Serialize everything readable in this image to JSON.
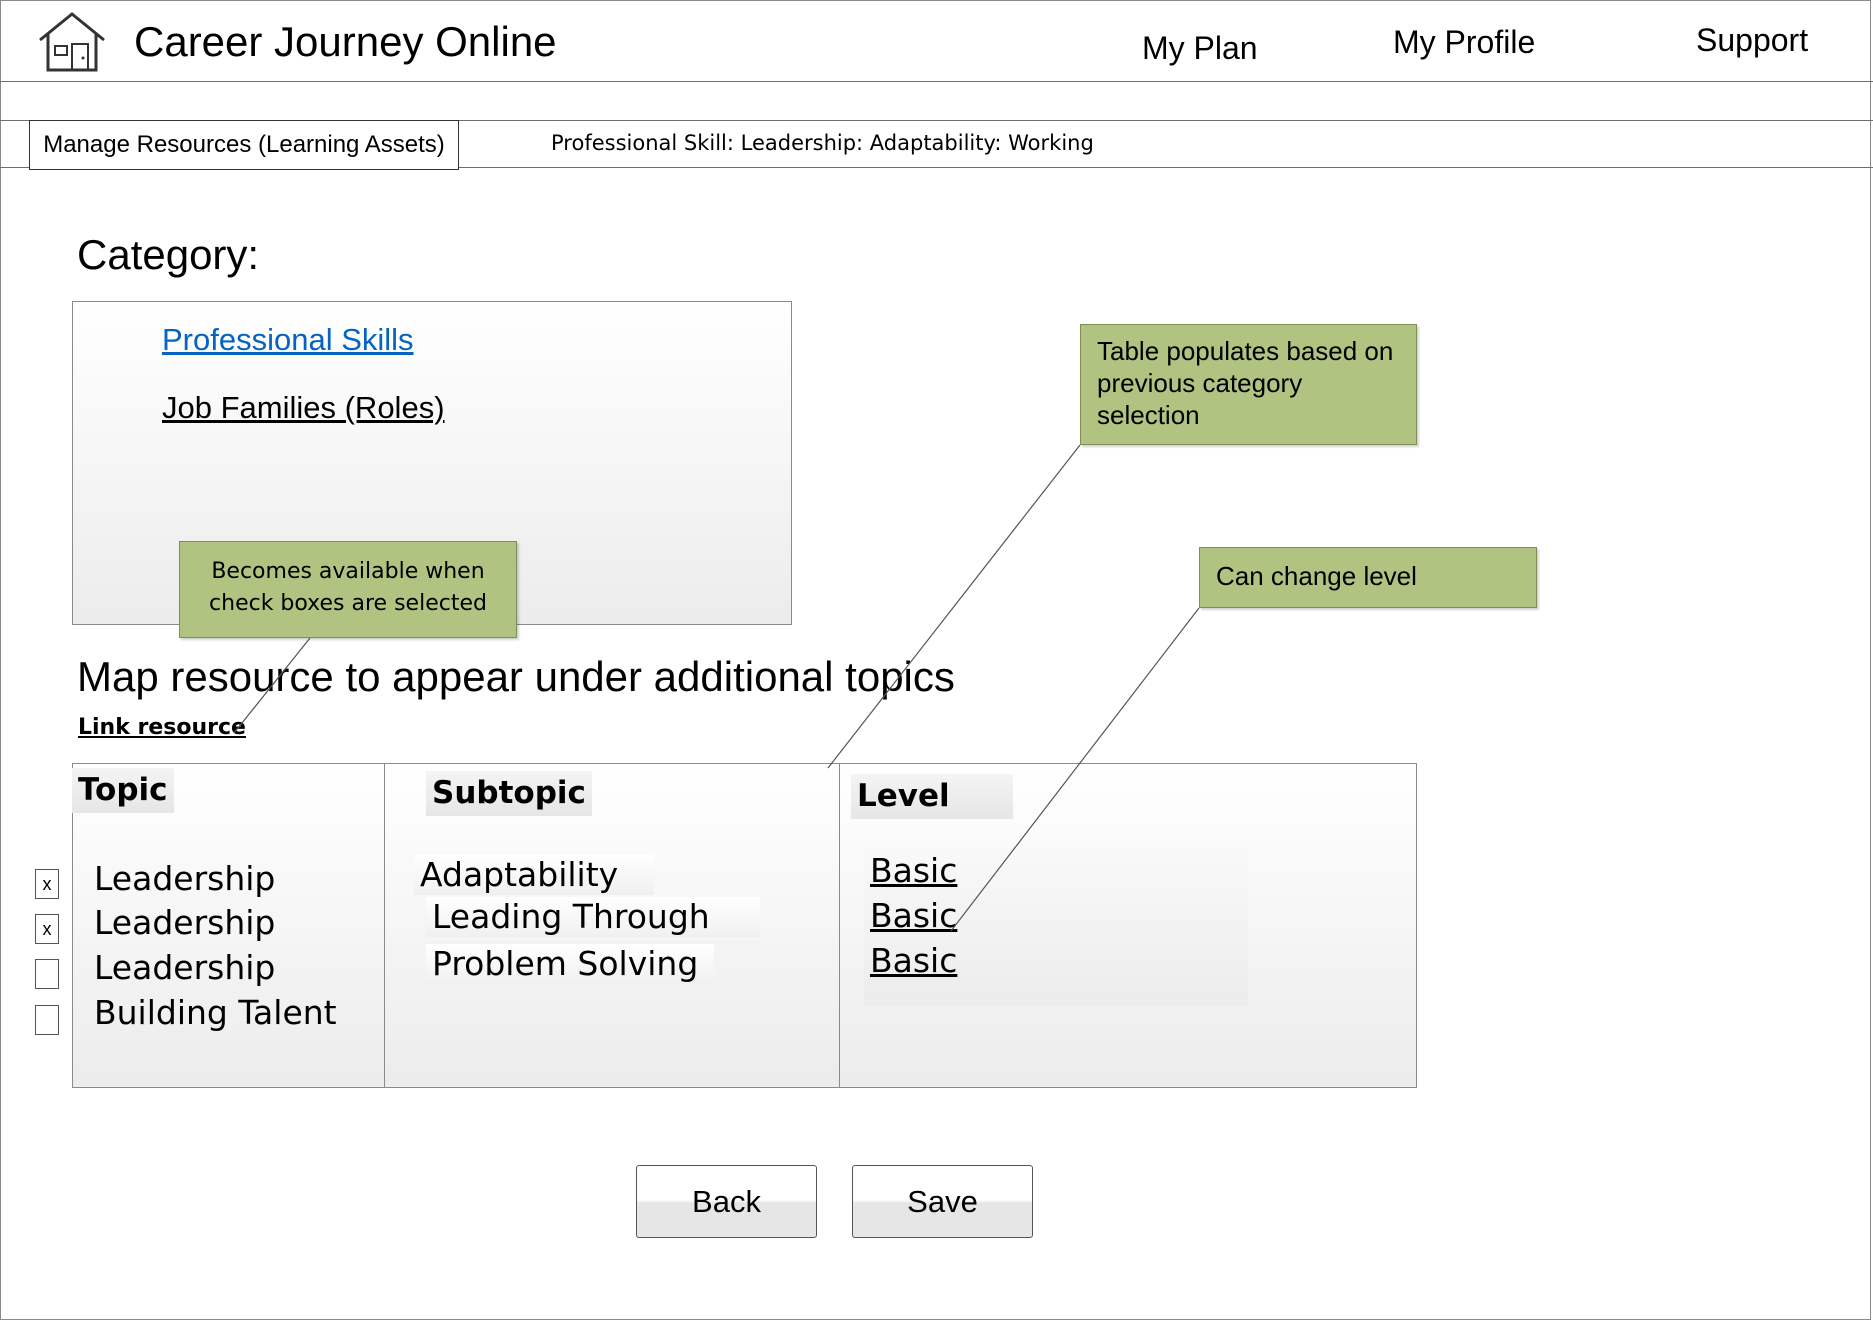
{
  "header": {
    "app_title": "Career Journey Online",
    "logo_icon": "house-icon",
    "nav": [
      "My Plan",
      "My Profile",
      "Support"
    ]
  },
  "toolbar": {
    "manage_label": "Manage Resources (Learning Assets)",
    "breadcrumb": "Professional Skill: Leadership: Adaptability: Working"
  },
  "category": {
    "heading": "Category:",
    "items": [
      "Professional Skills",
      "Job Families (Roles)"
    ],
    "selected_color": "#0563c1"
  },
  "mapping": {
    "heading": "Map resource to appear under additional topics",
    "link_resource": "Link resource"
  },
  "table": {
    "headers": [
      "Topic",
      "Subtopic",
      "Level"
    ],
    "rows": [
      {
        "checked": true,
        "check_mark": "x",
        "topic": "Leadership",
        "subtopic": "Adaptability",
        "level": "Basic"
      },
      {
        "checked": true,
        "check_mark": "x",
        "topic": "Leadership",
        "subtopic": "Leading Through",
        "level": "Basic"
      },
      {
        "checked": false,
        "check_mark": "",
        "topic": "Leadership",
        "subtopic": "Problem Solving",
        "level": "Basic"
      },
      {
        "checked": false,
        "check_mark": "",
        "topic": "Building Talent",
        "subtopic": "",
        "level": ""
      }
    ]
  },
  "annotations": {
    "table_populates": "Table populates based on previous category selection",
    "can_change_level": "Can change level",
    "becomes_available": "Becomes available when check boxes are selected",
    "color": "#b1c381"
  },
  "buttons": {
    "back": "Back",
    "save": "Save"
  }
}
